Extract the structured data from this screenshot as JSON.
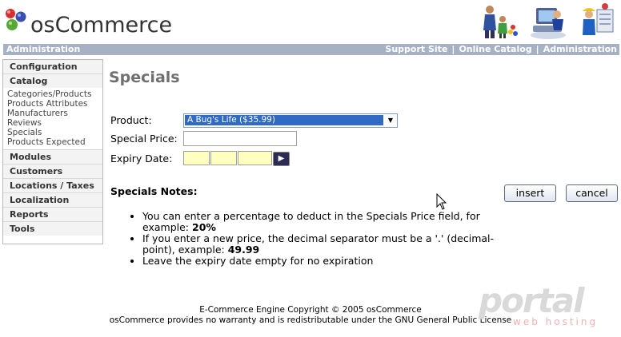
{
  "app": {
    "logo_text": "osCommerce"
  },
  "topbar": {
    "left_label": "Administration",
    "links": [
      "Support Site",
      "Online Catalog",
      "Administration"
    ],
    "separator": "|"
  },
  "sidebar": {
    "configuration": "Configuration",
    "catalog": "Catalog",
    "catalog_items": [
      "Categories/Products",
      "Products Attributes",
      "Manufacturers",
      "Reviews",
      "Specials",
      "Products Expected"
    ],
    "modules": "Modules",
    "customers": "Customers",
    "locations": "Locations / Taxes",
    "localization": "Localization",
    "reports": "Reports",
    "tools": "Tools"
  },
  "main": {
    "title": "Specials",
    "product_label": "Product:",
    "product_value": "A Bug's Life ($35.99)",
    "special_price_label": "Special Price:",
    "special_price_value": "",
    "expiry_label": "Expiry Date:",
    "expiry_day": "",
    "expiry_month": "",
    "expiry_year": "",
    "notes_title": "Specials Notes:",
    "insert_label": "insert",
    "cancel_label": "cancel",
    "note1_text": "You can enter a percentage to deduct in the Specials Price field, for example: ",
    "note1_bold": "20%",
    "note2_text": "If you enter a new price, the decimal separator must be a '.' (decimal-point), example: ",
    "note2_bold": "49.99",
    "note3_text": "Leave the expiry date empty for no expiration"
  },
  "footer": {
    "line1": "E-Commerce Engine Copyright © 2005 osCommerce",
    "line2": "osCommerce provides no warranty and is redistributable under the GNU General Public License"
  },
  "watermark": {
    "word": "portal",
    "sub": "web hosting"
  },
  "colors": {
    "topbar": "#a6b2c4",
    "selected": "#316ac5",
    "date_fill": "#ffffc0"
  }
}
